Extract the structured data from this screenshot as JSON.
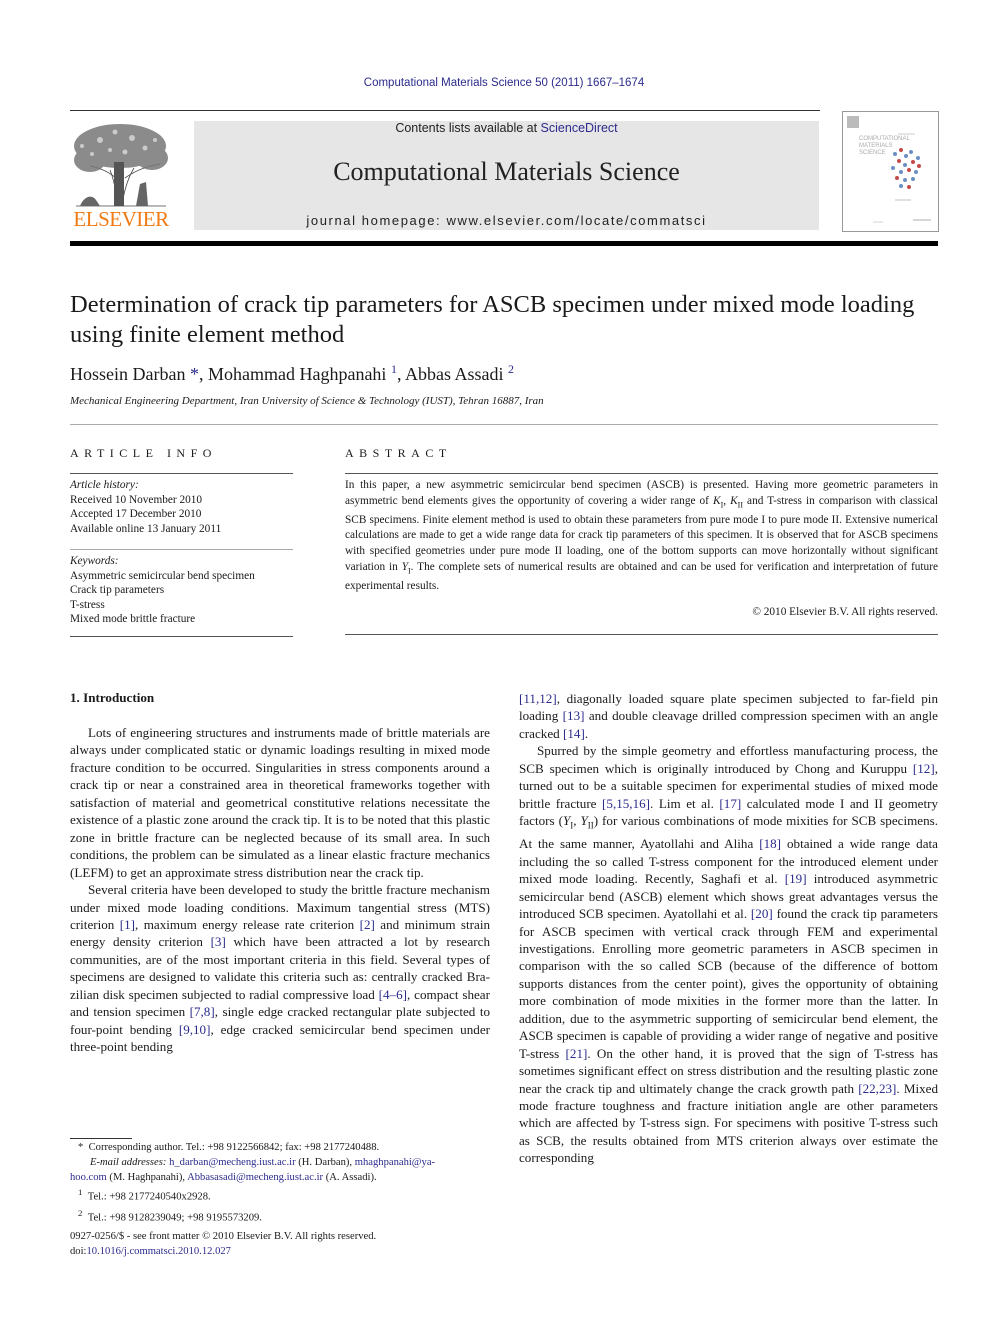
{
  "header": {
    "citation": "Computational Materials Science 50 (2011) 1667–1674",
    "contents_prefix": "Contents lists available at ",
    "contents_link": "ScienceDirect",
    "journal_title": "Computational Materials Science",
    "homepage": "journal homepage: www.elsevier.com/locate/commatsci",
    "publisher_logo_text": "ELSEVIER",
    "cover_title_lines": [
      "COMPUTATIONAL",
      "MATERIALS",
      "SCIENCE"
    ]
  },
  "colors": {
    "link": "#2b2b8c",
    "elsevier_orange": "#f07a13",
    "banner_bg": "#e6e6e6"
  },
  "article": {
    "title": "Determination of crack tip parameters for ASCB specimen under mixed mode loading using finite element method",
    "authors": [
      {
        "name": "Hossein Darban",
        "mark": "*"
      },
      {
        "name": "Mohammad Haghpanahi",
        "mark": "1"
      },
      {
        "name": "Abbas Assadi",
        "mark": "2"
      }
    ],
    "affiliation": "Mechanical Engineering Department, Iran University of Science & Technology (IUST), Tehran 16887, Iran"
  },
  "article_info": {
    "heading": "ARTICLE INFO",
    "history_label": "Article history:",
    "history": [
      "Received 10 November 2010",
      "Accepted 17 December 2010",
      "Available online 13 January 2011"
    ],
    "keywords_label": "Keywords:",
    "keywords": [
      "Asymmetric semicircular bend specimen",
      "Crack tip parameters",
      "T-stress",
      "Mixed mode brittle fracture"
    ]
  },
  "abstract": {
    "heading": "ABSTRACT",
    "text": "In this paper, a new asymmetric semicircular bend specimen (ASCB) is presented. Having more geometric parameters in asymmetric bend elements gives the opportunity of covering a wider range of K_I, K_II and T-stress in comparison with classical SCB specimens. Finite element method is used to obtain these parameters from pure mode I to pure mode II. Extensive numerical calculations are made to get a wide range data for crack tip parameters of this specimen. It is observed that for ASCB specimens with specified geometries under pure mode II loading, one of the bottom supports can move horizontally without significant variation in Y_I. The complete sets of numerical results are obtained and can be used for verification and interpretation of future experimental results.",
    "parts": [
      "In this paper, a new asymmetric semicircular bend specimen (ASCB) is presented. Having more geometric parameters in asymmetric bend elements gives the opportunity of covering a wider range of ",
      "K",
      "I",
      ", ",
      "K",
      "II",
      " and T-stress in comparison with classical SCB specimens. Finite element method is used to obtain these parameters from pure mode I to pure mode II. Extensive numerical calculations are made to get a wide range data for crack tip parameters of this specimen. It is observed that for ASCB specimens with specified geometries under pure mode II loading, one of the bottom supports can move horizontally without significant variation in ",
      "Y",
      "I",
      ". The complete sets of numerical results are obtained and can be used for verification and interpretation of future experimental results."
    ],
    "copyright": "© 2010 Elsevier B.V. All rights reserved."
  },
  "body": {
    "section_heading": "1. Introduction",
    "left_paragraphs": [
      [
        {
          "t": "Lots of engineering structures and instruments made of brittle materials are always under complicated static or dynamic loadings resulting in mixed mode fracture condition to be occurred. Singu­larities in stress components around a crack tip or near a con­strained area in theoretical frameworks together with satisfaction of material and geometrical constitutive relations necessitate the existence of a plastic zone around the crack tip. It is to be noted that this plastic zone in brittle fracture can be neglected because of its small area. In such conditions, the problem can be simulated as a linear elastic fracture mechanics (LEFM) to get an approximate stress distribution near the crack tip."
        }
      ],
      [
        {
          "t": "Several criteria have been developed to study the brittle frac­ture mechanism under mixed mode loading conditions. Maximum tangential stress (MTS) criterion "
        },
        {
          "c": "[1]"
        },
        {
          "t": ", maximum energy release rate criterion "
        },
        {
          "c": "[2]"
        },
        {
          "t": " and minimum strain energy density criterion "
        },
        {
          "c": "[3]"
        },
        {
          "t": " which have been attracted a lot by research communities, are of the most important criteria in this field. Several types of specimens are designed to validate this criteria such as: centrally cracked Bra­zilian disk specimen subjected to radial compressive load "
        },
        {
          "c": "[4–6]"
        },
        {
          "t": ", compact shear and tension specimen "
        },
        {
          "c": "[7,8]"
        },
        {
          "t": ", single edge cracked rectangular plate subjected to four-point bending "
        },
        {
          "c": "[9,10]"
        },
        {
          "t": ", edge cracked semicircular bend specimen under three-point bending"
        }
      ]
    ],
    "right_paragraphs": [
      [
        {
          "c": "[11,12]"
        },
        {
          "t": ", diagonally loaded square plate specimen subjected to far-field pin loading "
        },
        {
          "c": "[13]"
        },
        {
          "t": " and double cleavage drilled compression specimen with an angle cracked "
        },
        {
          "c": "[14]"
        },
        {
          "t": "."
        }
      ],
      [
        {
          "t": "Spurred by the simple geometry and effortless manufacturing process, the SCB specimen which is originally introduced by Chong and Kuruppu "
        },
        {
          "c": "[12]"
        },
        {
          "t": ", turned out to be a suitable specimen for exper­imental studies of mixed mode brittle fracture "
        },
        {
          "c": "[5,15,16]"
        },
        {
          "t": ". Lim et al. "
        },
        {
          "c": "[17]"
        },
        {
          "t": " calculated mode I and II geometry factors ("
        },
        {
          "i": "Y",
          "s": "I"
        },
        {
          "t": ", "
        },
        {
          "i": "Y",
          "s": "II"
        },
        {
          "t": ") for various combinations of mode mixities for SCB specimens. At the same manner, Ayatollahi and Aliha "
        },
        {
          "c": "[18]"
        },
        {
          "t": " obtained a wide range data including the so called T-stress component for the introduced ele­ment under mixed mode loading. Recently, Saghafi et al. "
        },
        {
          "c": "[19]"
        },
        {
          "t": " intro­duced asymmetric semicircular bend (ASCB) element which shows great advantages versus the introduced SCB specimen. Ayatollahi et al. "
        },
        {
          "c": "[20]"
        },
        {
          "t": " found the crack tip parameters for ASCB specimen with vertical crack through FEM and experimental investigations. Enrolling more geometric parameters in ASCB specimen in com­parison with the so called SCB (because of the difference of bottom supports distances from the center point), gives the opportunity of obtaining more combination of mode mixities in the former more than the latter. In addition, due to the asymmetric supporting of semicircular bend element, the ASCB specimen is capable of pro­viding a wider range of negative and positive T-stress "
        },
        {
          "c": "[21]"
        },
        {
          "t": ". On the other hand, it is proved that the sign of T-stress has sometimes significant effect on stress distribution and the resulting plastic zone near the crack tip and ultimately change the crack growth path "
        },
        {
          "c": "[22,23]"
        },
        {
          "t": ". Mixed mode fracture toughness and fracture initia­tion angle are other parameters which are affected by T-stress sign. For specimens with positive T-stress such as SCB, the results ob­tained from MTS criterion always over estimate the corresponding"
        }
      ]
    ]
  },
  "footnotes": {
    "corresponding": "Corresponding author. Tel.: +98 9122566842; fax: +98 2177240488.",
    "corresponding_mark": "*",
    "email_label": "E-mail addresses:",
    "email1": "h_darban@mecheng.iust.ac.ir",
    "email1_owner": " (H. Darban), ",
    "email2_part1": "mhaghpanahi@ya-",
    "email2_part2": "hoo.com",
    "email2_owner": " (M. Haghpanahi), ",
    "email3": "Abbasasadi@mecheng.iust.ac.ir",
    "email3_owner": " (A. Assadi).",
    "fn1_mark": "1",
    "fn1": "Tel.: +98 2177240540x2928.",
    "fn2_mark": "2",
    "fn2": "Tel.: +98 9128239049; +98 9195573209."
  },
  "front_matter": {
    "issn_line": "0927-0256/$ - see front matter © 2010 Elsevier B.V. All rights reserved.",
    "doi_prefix": "doi:",
    "doi": "10.1016/j.commatsci.2010.12.027"
  }
}
